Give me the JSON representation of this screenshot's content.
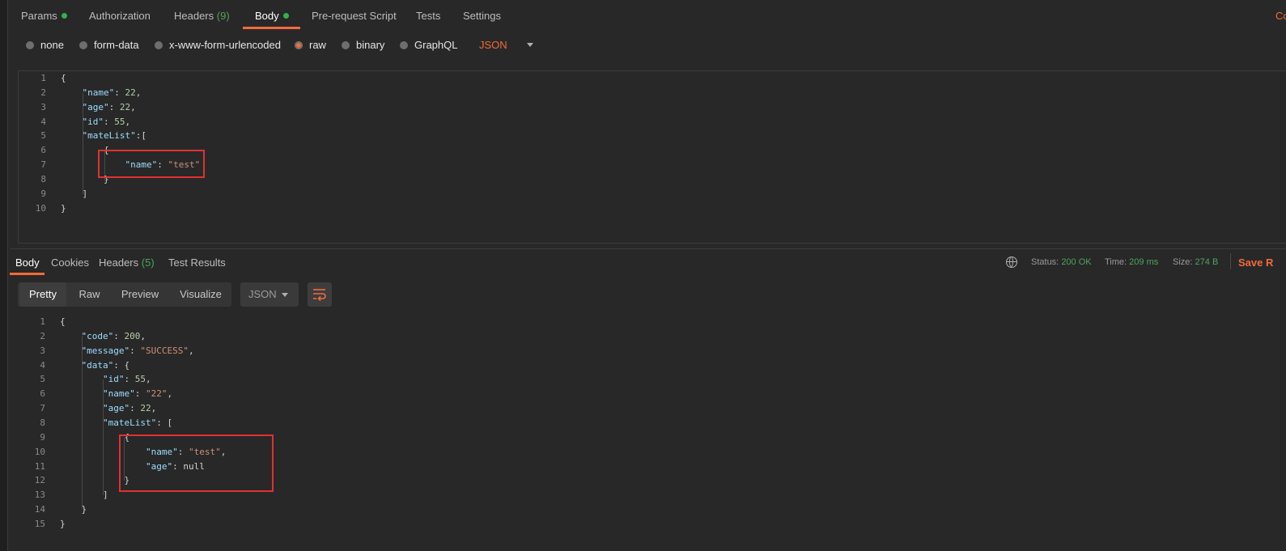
{
  "request_tabs": [
    {
      "label": "Params"
    },
    {
      "label": "Authorization"
    },
    {
      "label": "Headers",
      "count": "(9)"
    },
    {
      "label": "Body"
    },
    {
      "label": "Pre-request Script"
    },
    {
      "label": "Tests"
    },
    {
      "label": "Settings"
    }
  ],
  "cookies_link": "Co",
  "body_types": [
    "none",
    "form-data",
    "x-www-form-urlencoded",
    "raw",
    "binary",
    "GraphQL"
  ],
  "selected_body_type": "raw",
  "raw_language": "JSON",
  "request_code": [
    "{",
    "    \"name\": 22,",
    "    \"age\": 22,",
    "    \"id\": 55,",
    "    \"mateList\":[",
    "        {",
    "            \"name\": \"test\"",
    "        }",
    "    ]",
    "}"
  ],
  "response_tabs": [
    {
      "label": "Body"
    },
    {
      "label": "Cookies"
    },
    {
      "label": "Headers",
      "count": "(5)"
    },
    {
      "label": "Test Results"
    }
  ],
  "status": {
    "label": "Status:",
    "value": "200 OK"
  },
  "time": {
    "label": "Time:",
    "value": "209 ms"
  },
  "size": {
    "label": "Size:",
    "value": "274 B"
  },
  "save_response": "Save R",
  "view_modes": [
    "Pretty",
    "Raw",
    "Preview",
    "Visualize"
  ],
  "active_view": "Pretty",
  "response_format": "JSON",
  "response_code": [
    "{",
    "    \"code\": 200,",
    "    \"message\": \"SUCCESS\",",
    "    \"data\": {",
    "        \"id\": 55,",
    "        \"name\": \"22\",",
    "        \"age\": 22,",
    "        \"mateList\": [",
    "            {",
    "                \"name\": \"test\",",
    "                \"age\": null",
    "            }",
    "        ]",
    "    }",
    "}"
  ],
  "colors": {
    "accent": "#f26b3a",
    "success": "#4fa35f",
    "highlight_box": "#e03131"
  }
}
